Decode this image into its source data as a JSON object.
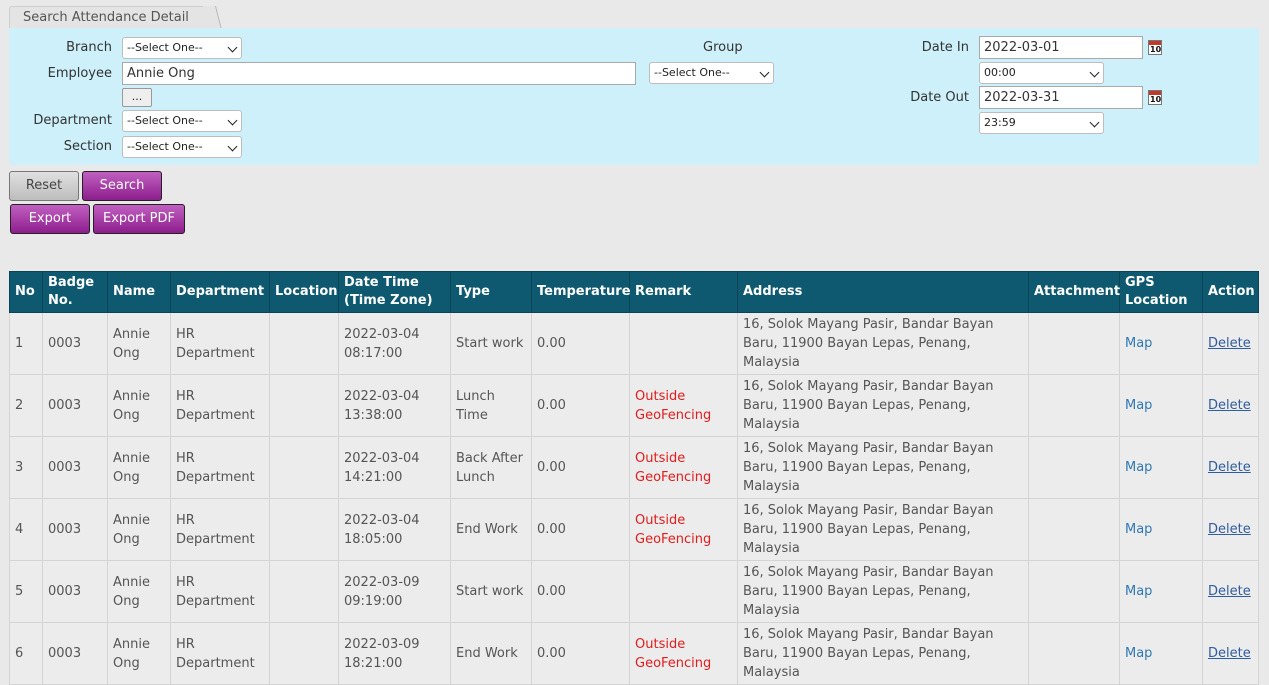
{
  "tab": {
    "label": "Search Attendance Detail"
  },
  "search": {
    "branch_label": "Branch",
    "branch_value": "--Select One--",
    "employee_label": "Employee",
    "employee_value": "Annie Ong",
    "lookup_label": "...",
    "department_label": "Department",
    "department_value": "--Select One--",
    "section_label": "Section",
    "section_value": "--Select One--",
    "group_label": "Group",
    "group_value": "--Select One--",
    "date_in_label": "Date In",
    "date_in_value": "2022-03-01",
    "time_in_value": "00:00",
    "date_out_label": "Date Out",
    "date_out_value": "2022-03-31",
    "time_out_value": "23:59",
    "calendar_glyph": "10"
  },
  "buttons": {
    "reset": "Reset",
    "search": "Search",
    "export": "Export",
    "export_pdf": "Export PDF"
  },
  "table": {
    "headers": [
      "No",
      "Badge No.",
      "Name",
      "Department",
      "Location",
      "Date Time (Time Zone)",
      "Type",
      "Temperature",
      "Remark",
      "Address",
      "Attachment",
      "GPS Location",
      "Action"
    ],
    "rows": [
      {
        "no": "1",
        "badge": "0003",
        "name": "Annie Ong",
        "dept": "HR Department",
        "location": "",
        "datetime": "2022-03-04 08:17:00",
        "type": "Start work",
        "temp": "0.00",
        "remark": "",
        "address": "16, Solok Mayang Pasir, Bandar Bayan Baru, 11900 Bayan Lepas, Penang, Malaysia",
        "attachment": "",
        "gps": "Map",
        "action": "Delete"
      },
      {
        "no": "2",
        "badge": "0003",
        "name": "Annie Ong",
        "dept": "HR Department",
        "location": "",
        "datetime": "2022-03-04 13:38:00",
        "type": "Lunch Time",
        "temp": "0.00",
        "remark": "Outside GeoFencing",
        "address": "16, Solok Mayang Pasir, Bandar Bayan Baru, 11900 Bayan Lepas, Penang, Malaysia",
        "attachment": "",
        "gps": "Map",
        "action": "Delete"
      },
      {
        "no": "3",
        "badge": "0003",
        "name": "Annie Ong",
        "dept": "HR Department",
        "location": "",
        "datetime": "2022-03-04 14:21:00",
        "type": "Back After Lunch",
        "temp": "0.00",
        "remark": "Outside GeoFencing",
        "address": "16, Solok Mayang Pasir, Bandar Bayan Baru, 11900 Bayan Lepas, Penang, Malaysia",
        "attachment": "",
        "gps": "Map",
        "action": "Delete"
      },
      {
        "no": "4",
        "badge": "0003",
        "name": "Annie Ong",
        "dept": "HR Department",
        "location": "",
        "datetime": "2022-03-04 18:05:00",
        "type": "End Work",
        "temp": "0.00",
        "remark": "Outside GeoFencing",
        "address": "16, Solok Mayang Pasir, Bandar Bayan Baru, 11900 Bayan Lepas, Penang, Malaysia",
        "attachment": "",
        "gps": "Map",
        "action": "Delete"
      },
      {
        "no": "5",
        "badge": "0003",
        "name": "Annie Ong",
        "dept": "HR Department",
        "location": "",
        "datetime": "2022-03-09 09:19:00",
        "type": "Start work",
        "temp": "0.00",
        "remark": "",
        "address": "16, Solok Mayang Pasir, Bandar Bayan Baru, 11900 Bayan Lepas, Penang, Malaysia",
        "attachment": "",
        "gps": "Map",
        "action": "Delete"
      },
      {
        "no": "6",
        "badge": "0003",
        "name": "Annie Ong",
        "dept": "HR Department",
        "location": "",
        "datetime": "2022-03-09 18:21:00",
        "type": "End Work",
        "temp": "0.00",
        "remark": "Outside GeoFencing",
        "address": "16, Solok Mayang Pasir, Bandar Bayan Baru, 11900 Bayan Lepas, Penang, Malaysia",
        "attachment": "",
        "gps": "Map",
        "action": "Delete"
      }
    ]
  },
  "colors": {
    "panel": "#cdf0fb",
    "header": "#0f5970",
    "button_purple": "#8d1d8d",
    "remark_red": "#e21d1d",
    "link_blue": "#2f78b5"
  }
}
